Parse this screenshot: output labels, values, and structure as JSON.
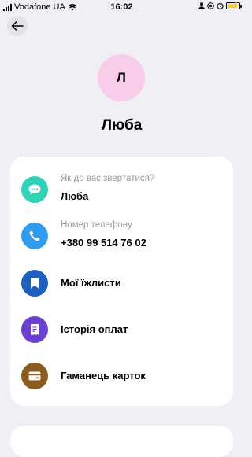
{
  "status_bar": {
    "carrier": "Vodafone UA",
    "time": "16:02",
    "battery_color": "#f4d23b"
  },
  "header": {
    "back_icon": "arrow-left-icon"
  },
  "profile": {
    "avatar_letter": "Л",
    "avatar_color": "#f8cdea",
    "name": "Люба"
  },
  "info_card": {
    "name_field": {
      "label": "Як до вас звертатися?",
      "value": "Люба",
      "icon": "chat-bubble-icon",
      "icon_color": "#2fd3b8"
    },
    "phone_field": {
      "label": "Номер телефону",
      "value": "+380 99 514 76 02",
      "icon": "phone-icon",
      "icon_color": "#2f9cf0"
    },
    "menu_items": [
      {
        "label": "Мої їжлисти",
        "icon": "bookmark-icon",
        "icon_color": "#1e5fbf"
      },
      {
        "label": "Історія оплат",
        "icon": "receipt-icon",
        "icon_color": "#6b3fd0"
      },
      {
        "label": "Гаманець карток",
        "icon": "wallet-card-icon",
        "icon_color": "#8a5a1e"
      }
    ]
  }
}
